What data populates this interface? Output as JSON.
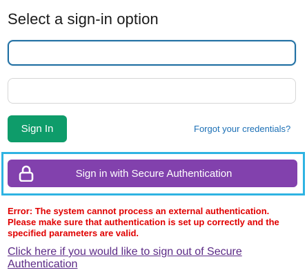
{
  "title": "Select a sign-in option",
  "username_field": {
    "value": "",
    "placeholder": ""
  },
  "password_field": {
    "value": "",
    "placeholder": ""
  },
  "signin_button": "Sign In",
  "forgot_link": "Forgot your credentials?",
  "secure_auth_button": {
    "label": "Sign in with Secure Authentication",
    "icon": "lock-icon"
  },
  "error_message": "Error: The system cannot process an external authentication. Please make sure that authentication is set up correctly and the specified parameters are valid.",
  "signout_link": "Click here if you would like to sign out of Secure Authentication",
  "colors": {
    "signin_green": "#0e9c6a",
    "secure_purple": "#8241ad",
    "focus_highlight": "#2eb3e2",
    "error_red": "#e00000",
    "link_blue": "#1b6fb5",
    "link_purple": "#5b2a86"
  }
}
